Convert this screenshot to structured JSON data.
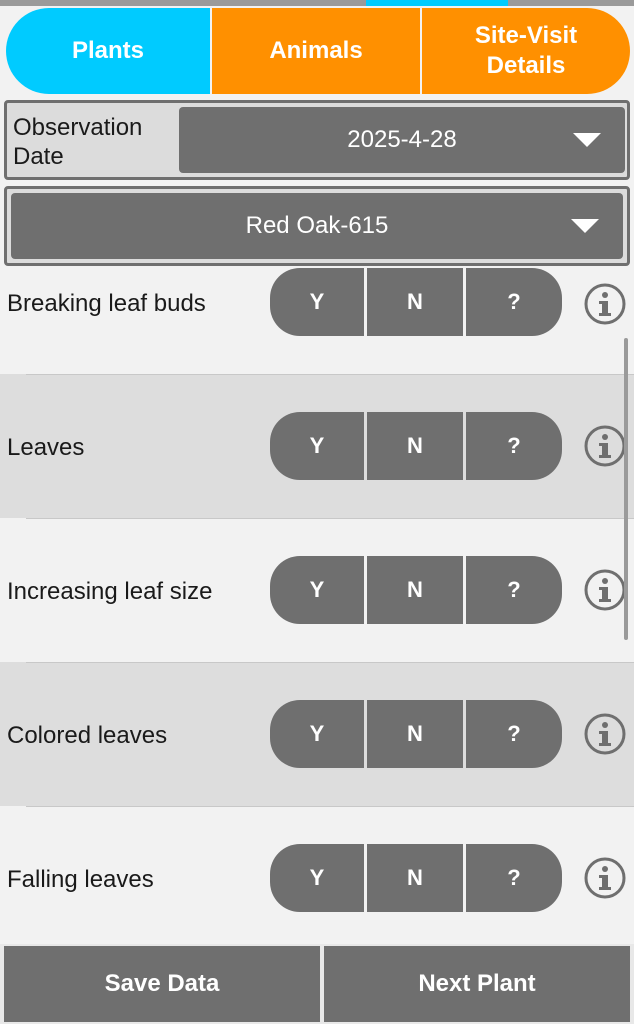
{
  "colors": {
    "plants_tab": "#00cbff",
    "other_tabs": "#ff9000",
    "button_gray": "#6f6f6f",
    "row_light": "#f2f2f2",
    "row_dark": "#dddddd"
  },
  "tabs": [
    {
      "label": "Plants",
      "selected": true
    },
    {
      "label": "Animals",
      "selected": false
    },
    {
      "label": "Site-Visit\nDetails",
      "selected": false
    }
  ],
  "observation": {
    "label": "Observation\nDate",
    "date_value": "2025-4-28"
  },
  "plant_select": {
    "value": "Red Oak-615"
  },
  "phenophases": [
    {
      "label": "Breaking leaf buds",
      "yes": "Y",
      "no": "N",
      "unsure": "?",
      "info_icon": "info-circle-icon"
    },
    {
      "label": "Leaves",
      "yes": "Y",
      "no": "N",
      "unsure": "?",
      "info_icon": "info-circle-icon"
    },
    {
      "label": "Increasing leaf size",
      "yes": "Y",
      "no": "N",
      "unsure": "?",
      "info_icon": "info-circle-icon"
    },
    {
      "label": "Colored leaves",
      "yes": "Y",
      "no": "N",
      "unsure": "?",
      "info_icon": "info-circle-icon"
    },
    {
      "label": "Falling leaves",
      "yes": "Y",
      "no": "N",
      "unsure": "?",
      "info_icon": "info-circle-icon"
    }
  ],
  "footer": {
    "save_label": "Save Data",
    "next_label": "Next Plant"
  }
}
